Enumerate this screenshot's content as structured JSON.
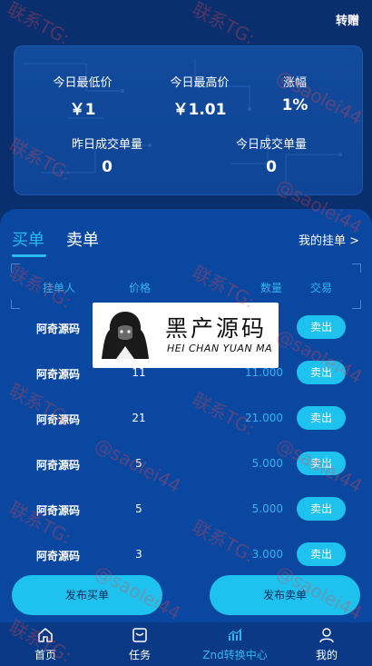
{
  "header": {
    "transfer_label": "转赠"
  },
  "stats": {
    "low_label": "今日最低价",
    "low_value": "￥1",
    "high_label": "今日最高价",
    "high_value": "￥1.01",
    "amp_label": "涨幅",
    "amp_value": "1%",
    "yday_label": "昨日成交单量",
    "yday_value": "0",
    "today_label": "今日成交单量",
    "today_value": "0"
  },
  "market": {
    "tab_buy": "买单",
    "tab_sell": "卖单",
    "my_orders": "我的挂单 >",
    "columns": {
      "owner": "挂单人",
      "price": "价格",
      "qty": "数量",
      "trade": "交易"
    },
    "rows": [
      {
        "owner": "阿奇源码",
        "price": "",
        "qty": "",
        "action": "卖出"
      },
      {
        "owner": "阿奇源码",
        "price": "11",
        "qty": "11.000",
        "action": "卖出"
      },
      {
        "owner": "阿奇源码",
        "price": "21",
        "qty": "21.000",
        "action": "卖出"
      },
      {
        "owner": "阿奇源码",
        "price": "5",
        "qty": "5.000",
        "action": "卖出"
      },
      {
        "owner": "阿奇源码",
        "price": "5",
        "qty": "5.000",
        "action": "卖出"
      },
      {
        "owner": "阿奇源码",
        "price": "3",
        "qty": "3.000",
        "action": "卖出"
      }
    ]
  },
  "overlay": {
    "title": "黑产源码",
    "subtitle": "HEI CHAN YUAN MA"
  },
  "actions": {
    "publish_buy": "发布买单",
    "publish_sell": "发布卖单"
  },
  "nav": {
    "home": "首页",
    "task": "任务",
    "swap": "Znd转换中心",
    "mine": "我的"
  },
  "watermark": {
    "contact": "联系TG:",
    "handle": "@saolei44"
  },
  "colors": {
    "accent": "#1ec2ef",
    "tab_active": "#27b9f0",
    "panel": "#0a47a0",
    "watermark": "#eb4646"
  }
}
